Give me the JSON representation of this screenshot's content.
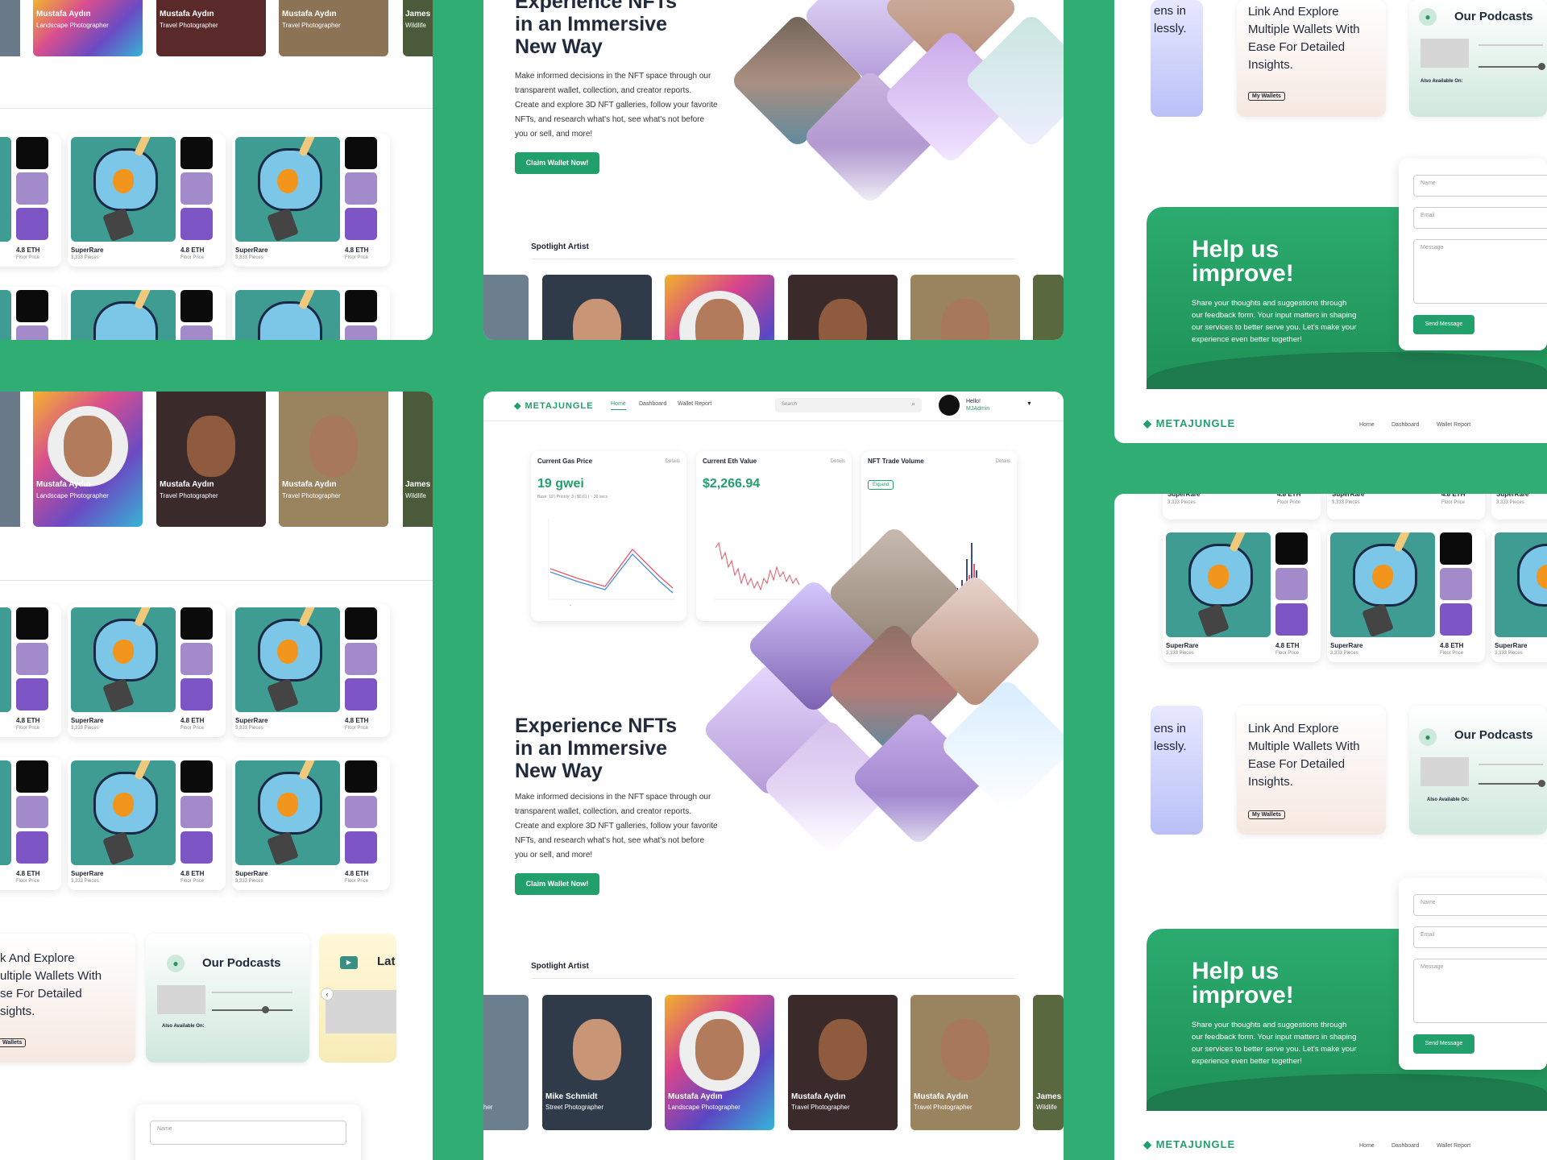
{
  "hero": {
    "title": "Experience NFTs in an Immersive Way",
    "title_l1": "Experience NFTs",
    "title_l2": "in an Immersive",
    "title_l3": "New Way",
    "body": [
      "Make informed decisions in the NFT space through our",
      "transparent wallet, collection, and creator reports.",
      "Create and explore 3D NFT galleries, follow your favorite",
      "NFTs, and research what's hot, see what's not before",
      "you or sell, and more!"
    ],
    "cta": "Claim Wallet Now!"
  },
  "spotlight": {
    "heading": "Spotlight Artist",
    "artists": [
      {
        "name": "Mike Schmidt",
        "role": "Street Photographer"
      },
      {
        "name": "Mustafa Aydın",
        "role": "Landscape Photographer"
      },
      {
        "name": "Mustafa Aydın",
        "role": "Travel Photographer"
      },
      {
        "name": "Mustafa Aydın",
        "role": "Travel Photographer"
      },
      {
        "name": "James",
        "role": "Wildlife"
      }
    ]
  },
  "nft": {
    "name": "SuperRare",
    "pieces": "3,333 Pieces",
    "price": "4.8 ETH",
    "price_label": "Floor Price"
  },
  "nav": {
    "logo": "METAJUNGLE",
    "links": [
      "Home",
      "Dashboard",
      "Wallet Report"
    ],
    "search_placeholder": "Search",
    "greeting": "Hello!",
    "user": "MJAdmin"
  },
  "stats": [
    {
      "title": "Current Gas Price",
      "details": "Details",
      "value": "19 gwei",
      "sub": "Base: 19 | Priority: 3 | $0.61 | ~ 30 secs"
    },
    {
      "title": "Current Eth Value",
      "details": "Details",
      "value": "$2,266.94"
    },
    {
      "title": "NFT Trade Volume",
      "details": "Details",
      "expand": "Expand"
    }
  ],
  "features": {
    "link_title_l1": "Link And Explore",
    "link_title_l2": "Multiple Wallets With",
    "link_title_l3": "Ease For Detailed",
    "link_title_l4": "Insights.",
    "link_btn": "My Wallets",
    "podcast_title": "Our Podcasts",
    "also": "Also Available On:",
    "latest": "Lat",
    "left_frag_1": "ens in",
    "left_frag_2": "lessly.",
    "left_link_l1": "k And Explore",
    "left_link_l2": "ultiple Wallets With",
    "left_link_l3": "se For Detailed",
    "left_link_l4": "sights.",
    "left_btn": "Wallets"
  },
  "help": {
    "title_l1": "Help us",
    "title_l2": "improve!",
    "body": [
      "Share your thoughts and suggestions through",
      "our feedback form. Your input matters in shaping",
      "our services to better serve you. Let's make your",
      "experience even better together!"
    ],
    "name": "Name",
    "email": "Email",
    "message": "Message",
    "send": "Send Message"
  },
  "colors": {
    "brand": "#2FAD73",
    "accent": "#22a06b",
    "line_red": "#e05a67",
    "line_blue": "#4a8fd8"
  }
}
